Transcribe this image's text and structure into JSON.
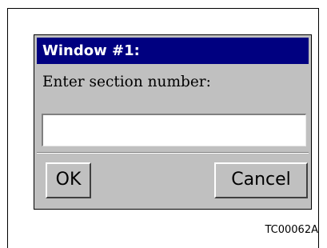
{
  "dialog": {
    "title": "Window #1:",
    "prompt": "Enter section number:",
    "input_value": "",
    "ok_label": "OK",
    "cancel_label": "Cancel"
  },
  "figure": {
    "caption": "TC00062A"
  },
  "colors": {
    "titlebar": "#000080",
    "dialog_background": "#c0c0c0",
    "input_background": "#ffffff"
  }
}
